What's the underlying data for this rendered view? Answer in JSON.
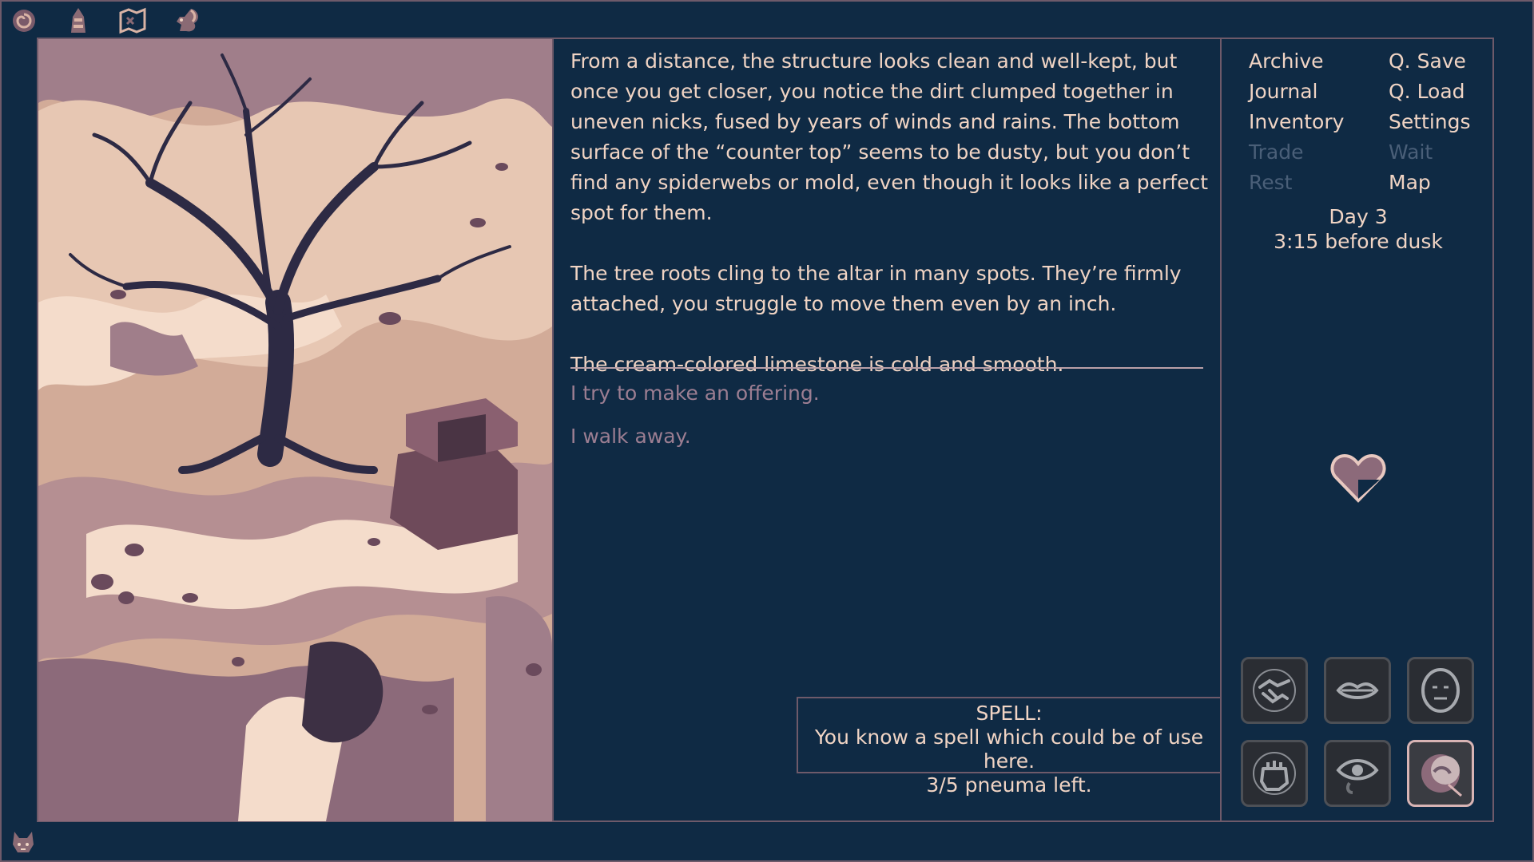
{
  "toolbar": {
    "icons": [
      "spiral-icon",
      "tower-icon",
      "map-scroll-icon",
      "squirrel-icon"
    ]
  },
  "narrative": {
    "paragraphs": [
      "From a distance, the structure looks clean and well-kept, but once you get closer, you notice the dirt clumped together in uneven nicks, fused by years of winds and rains. The bottom surface of the “counter top” seems to be dusty, but you don’t find any spiderwebs or mold, even though it looks like a perfect spot for them.",
      "The tree roots cling to the altar in many spots. They’re firmly attached, you struggle to move them even by an inch.",
      "The cream-colored limestone is cold and smooth."
    ],
    "choices": [
      "I try to make an offering.",
      "I walk away."
    ]
  },
  "menu": {
    "archive": "Archive",
    "journal": "Journal",
    "inventory": "Inventory",
    "trade": "Trade",
    "rest": "Rest",
    "q_save": "Q. Save",
    "q_load": "Q. Load",
    "settings": "Settings",
    "wait": "Wait",
    "map": "Map"
  },
  "status": {
    "day": "Day 3",
    "time": "3:15 before dusk"
  },
  "spell_tooltip": {
    "title": "SPELL:",
    "line1": "You know a spell which could be of use here.",
    "line2": "3/5 pneuma left."
  },
  "abilities": [
    "handshake-icon",
    "lips-icon",
    "face-icon",
    "fist-icon",
    "eye-icon",
    "spell-orb-icon"
  ],
  "colors": {
    "background": "#0f2a44",
    "text": "#f0d4c4",
    "choice_text": "#9c7e92",
    "disabled_text": "#4a5f78",
    "border": "#6e5a6a"
  }
}
